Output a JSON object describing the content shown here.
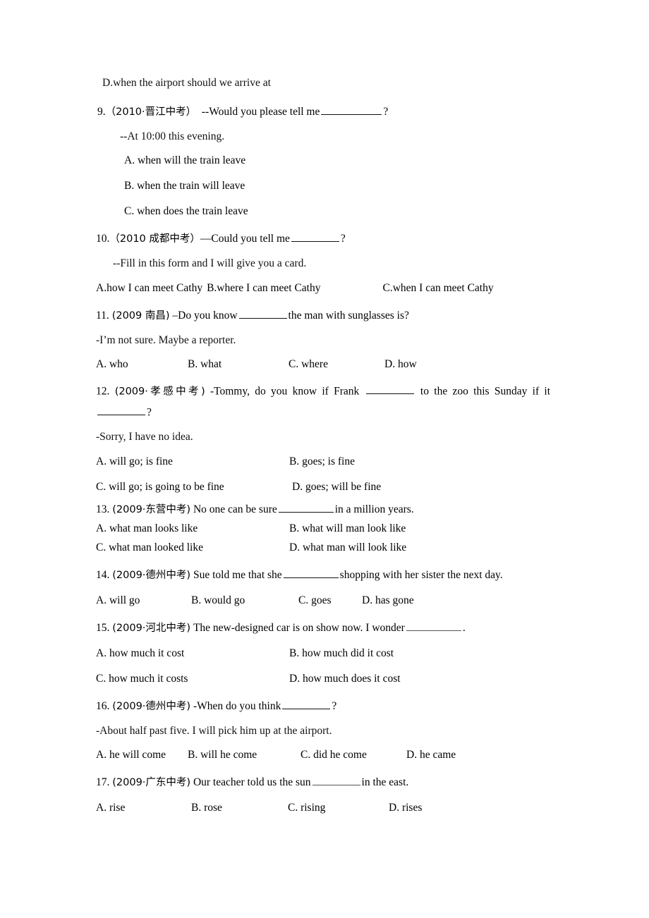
{
  "document": {
    "orphan_option": "D.when the airport should we arrive at"
  },
  "questions": [
    {
      "number": "9.",
      "source": "（2010·晋江中考）",
      "stem_before": "--Would you please tell me",
      "stem_after": "?",
      "answer_line": "--At 10:00 this evening.",
      "options": [
        "A. when will the train leave",
        "B. when the train will leave",
        "C. when does the train leave"
      ]
    },
    {
      "number": "10.",
      "source": "（2010 成都中考）",
      "stem_before": "—Could you tell me",
      "stem_after": "?",
      "answer_line": "--Fill in this form and I will give you a card.",
      "options": [
        "A.how I can meet Cathy",
        "B.where I can meet Cathy",
        "C.when I can meet Cathy"
      ]
    },
    {
      "number": "11.",
      "source": "(2009 南昌)",
      "stem_before": "–Do you know",
      "stem_after": "the man with sunglasses is?",
      "answer_line": "-I’m not sure. Maybe a reporter.",
      "options": [
        "A. who",
        "B. what",
        "C. where",
        "D. how"
      ]
    },
    {
      "number": "12.",
      "source": "(2009·孝感中考)",
      "stem_before": "-Tommy, do you know if Frank",
      "stem_mid": "to the zoo this Sunday if it",
      "stem_after": "?",
      "answer_line": "-Sorry, I have no idea.",
      "options": [
        "A. will go; is fine",
        "B. goes; is fine",
        "C. will go; is going to be fine",
        "D. goes; will be fine"
      ]
    },
    {
      "number": "13.",
      "source": "(2009·东营中考)",
      "stem_before": "No one can be sure",
      "stem_after": "in a million years.",
      "options": [
        "A. what man looks like",
        "B. what will man look like",
        "C. what man looked like",
        "D. what man will look like"
      ]
    },
    {
      "number": "14.",
      "source": "(2009·德州中考)",
      "stem_before": "Sue told me that she",
      "stem_after": "shopping with her sister the next day.",
      "options": [
        "A. will go",
        "B. would go",
        "C. goes",
        "D. has gone"
      ]
    },
    {
      "number": "15.",
      "source": "(2009·河北中考)",
      "stem_before": "The new-designed car is on show now. I wonder",
      "stem_after": ".",
      "options": [
        "A. how much it cost",
        "B. how much did it cost",
        "C. how much it costs",
        "D. how much does it cost"
      ]
    },
    {
      "number": "16.",
      "source": "(2009·德州中考)",
      "stem_before": "-When do you think",
      "stem_after": "?",
      "answer_line": "-About half past five. I will pick him up at the airport.",
      "options": [
        "A. he will come",
        "B. will he come",
        "C. did he come",
        "D. he came"
      ]
    },
    {
      "number": "17.",
      "source": "(2009·广东中考)",
      "stem_before": "Our teacher told us the sun",
      "stem_after": "in the east.",
      "options": [
        "A. rise",
        "B. rose",
        "C. rising",
        "D. rises"
      ]
    }
  ]
}
